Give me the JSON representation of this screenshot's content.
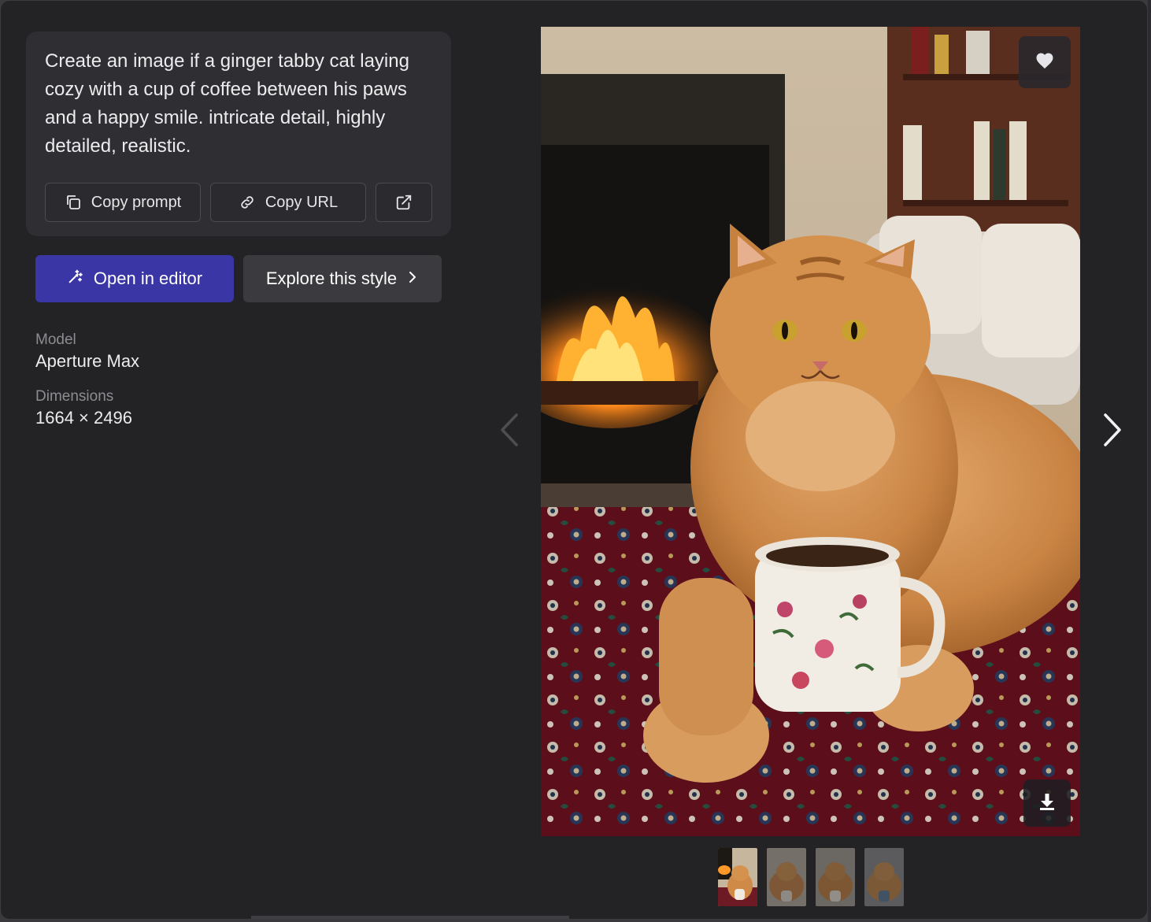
{
  "prompt": {
    "text": "Create an image if a ginger tabby cat laying cozy with a cup of coffee between his paws and a happy smile. intricate detail, highly detailed, realistic.",
    "copy_prompt_label": "Copy prompt",
    "copy_url_label": "Copy URL"
  },
  "actions": {
    "open_editor_label": "Open in editor",
    "explore_style_label": "Explore this style"
  },
  "details": {
    "model_label": "Model",
    "model_value": "Aperture Max",
    "dimensions_label": "Dimensions",
    "dimensions_value": "1664 × 2496"
  },
  "thumbnails": [
    {
      "selected": true
    },
    {
      "selected": false
    },
    {
      "selected": false
    },
    {
      "selected": false
    }
  ],
  "colors": {
    "accent": "#3a36a6",
    "panel": "#2f2f33",
    "background": "#232325"
  }
}
